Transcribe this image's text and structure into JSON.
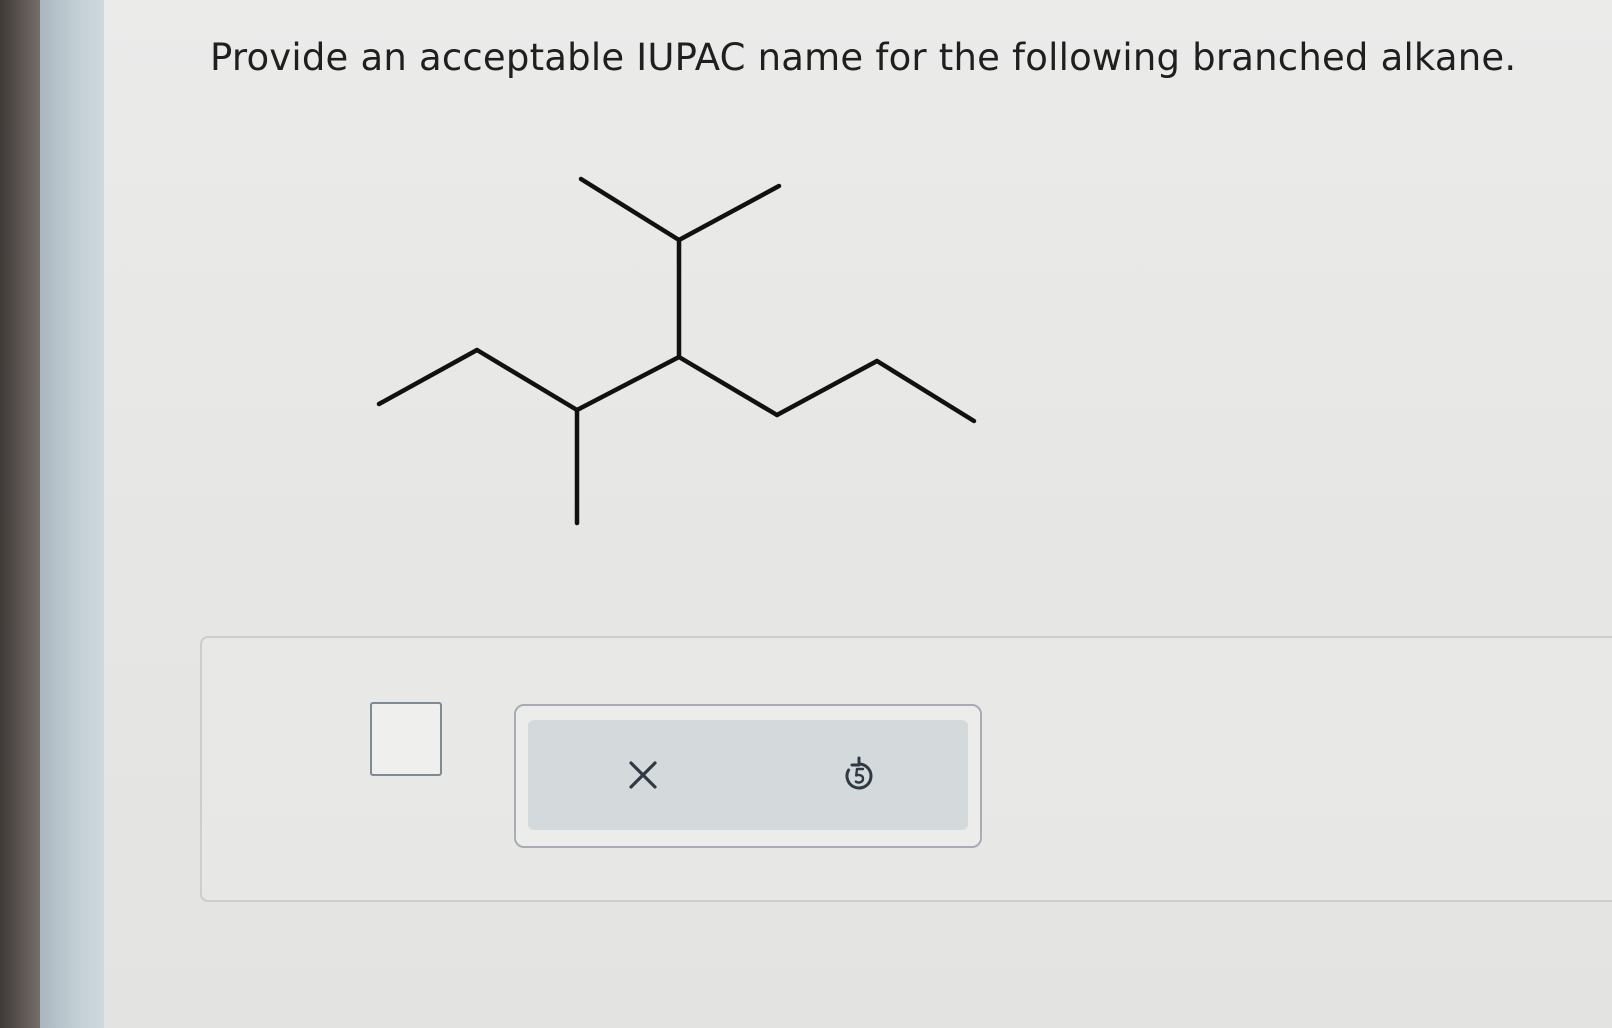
{
  "question": {
    "text": "Provide an acceptable IUPAC name for the following branched alkane."
  },
  "answer": {
    "value": ""
  },
  "toolbar": {
    "clear_icon": "close-icon",
    "undo_icon": "undo-icon"
  },
  "colors": {
    "page_background": "#e9e9e7",
    "bond_color": "#111111",
    "toolbar_fill": "#d4d9dc",
    "icon_color": "#2f3a44"
  }
}
